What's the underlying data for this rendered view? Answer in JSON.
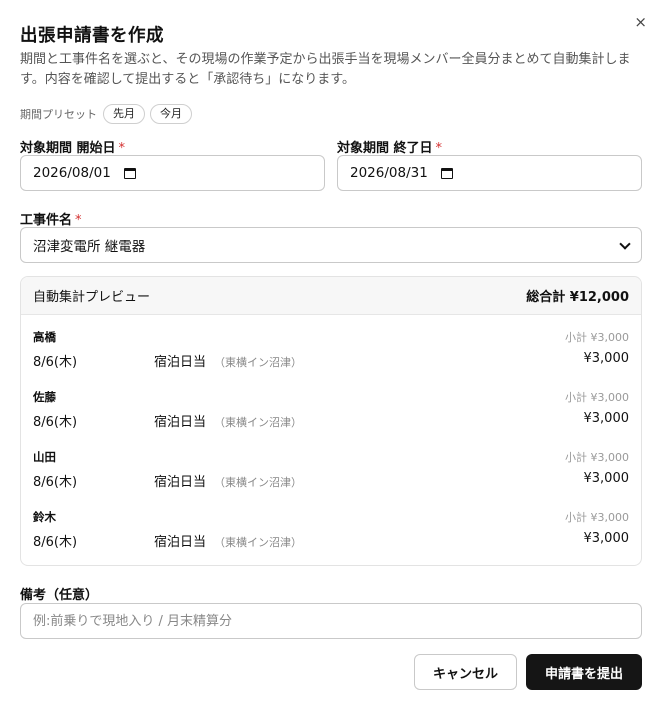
{
  "dialog": {
    "title": "出張申請書を作成",
    "description": "期間と工事件名を選ぶと、その現場の作業予定から出張手当を現場メンバー全員分まとめて自動集計します。内容を確認して提出すると「承認待ち」になります。",
    "close_label": "×"
  },
  "preset": {
    "label": "期間プリセット",
    "options": [
      "先月",
      "今月"
    ]
  },
  "period": {
    "start_label": "対象期間 開始日",
    "start_value": "2026/08/01",
    "end_label": "対象期間 終了日",
    "end_value": "2026/08/31",
    "required_mark": "*"
  },
  "project": {
    "label": "工事件名",
    "value": "沼津変電所 継電器"
  },
  "preview": {
    "title": "自動集計プレビュー",
    "total": "総合計 ¥12,000",
    "members": [
      {
        "name": "高橋",
        "subtotal": "小計 ¥3,000",
        "date": "8/6(木)",
        "item": "宿泊日当",
        "location": "（東横イン沼津）",
        "amount": "¥3,000"
      },
      {
        "name": "佐藤",
        "subtotal": "小計 ¥3,000",
        "date": "8/6(木)",
        "item": "宿泊日当",
        "location": "（東横イン沼津）",
        "amount": "¥3,000"
      },
      {
        "name": "山田",
        "subtotal": "小計 ¥3,000",
        "date": "8/6(木)",
        "item": "宿泊日当",
        "location": "（東横イン沼津）",
        "amount": "¥3,000"
      },
      {
        "name": "鈴木",
        "subtotal": "小計 ¥3,000",
        "date": "8/6(木)",
        "item": "宿泊日当",
        "location": "（東横イン沼津）",
        "amount": "¥3,000"
      }
    ]
  },
  "notes": {
    "label": "備考（任意）",
    "placeholder": "例:前乗りで現地入り / 月末精算分",
    "value": ""
  },
  "actions": {
    "cancel_label": "キャンセル",
    "submit_label": "申請書を提出"
  }
}
